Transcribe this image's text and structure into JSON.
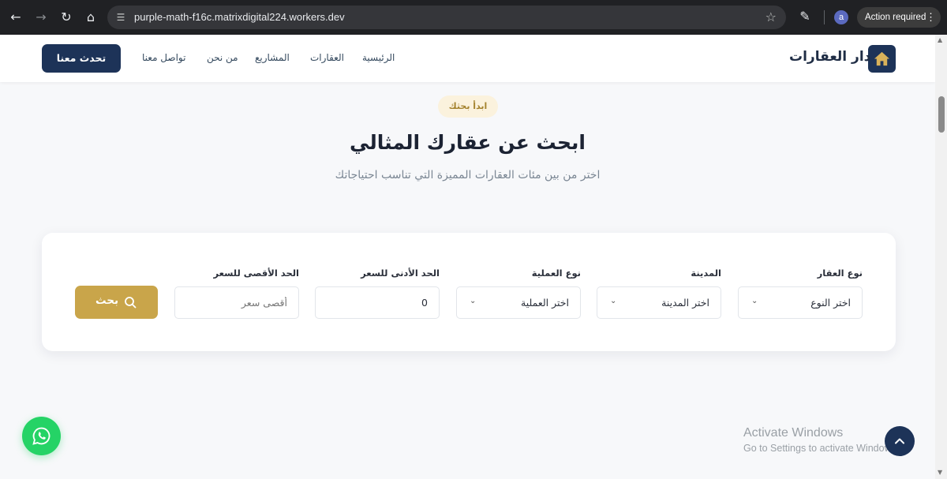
{
  "browser": {
    "url": "purple-math-f16c.matrixdigital224.workers.dev",
    "profile_initial": "a",
    "action_required": "Action required",
    "icons": [
      "back-icon",
      "forward-icon",
      "reload-icon",
      "home-icon",
      "site-settings-icon",
      "star-icon",
      "extensions-icon",
      "more-icon"
    ]
  },
  "header": {
    "logo_text": "دار العقارات",
    "nav": [
      "الرئيسية",
      "العقارات",
      "المشاريع",
      "من نحن",
      "تواصل معنا"
    ],
    "cta": "تحدث معنا"
  },
  "hero": {
    "badge": "ابدأ بحثك",
    "title": "ابحث عن عقارك المثالي",
    "subtitle": "اختر من بين مئات العقارات المميزة التي تناسب احتياجاتك"
  },
  "search": {
    "property_type": {
      "label": "نوع العقار",
      "value": "اختر النوع"
    },
    "city": {
      "label": "المدينة",
      "value": "اختر المدينة"
    },
    "operation": {
      "label": "نوع العملية",
      "value": "اختر العملية"
    },
    "min_price": {
      "label": "الحد الأدنى للسعر",
      "value": "0"
    },
    "max_price": {
      "label": "الحد الأقصى للسعر",
      "placeholder": "أقصى سعر"
    },
    "button": "بحث"
  },
  "watermark": {
    "title": "Activate Windows",
    "subtitle": "Go to Settings to activate Windows."
  },
  "colors": {
    "navy": "#1d3358",
    "gold": "#c9a54a",
    "whatsapp": "#25d366"
  }
}
